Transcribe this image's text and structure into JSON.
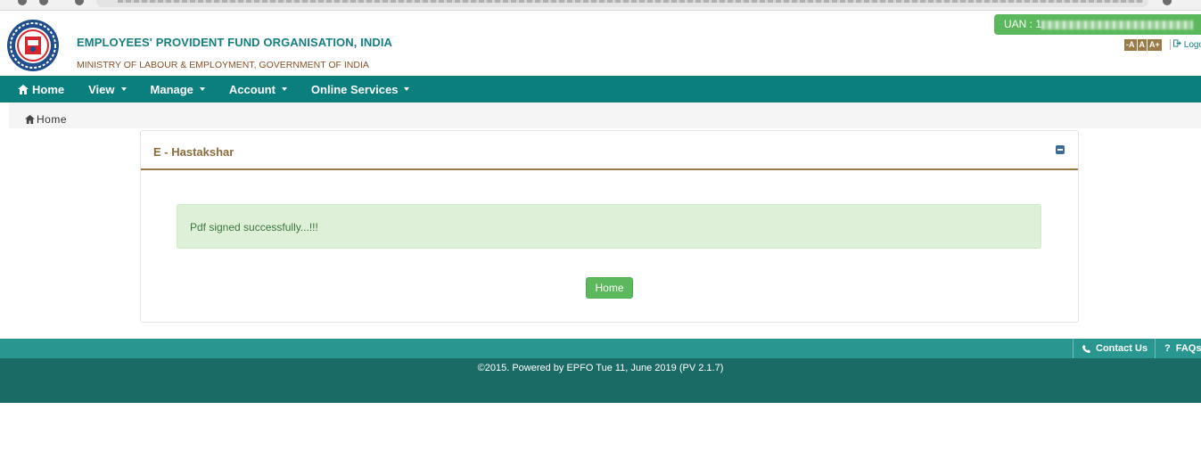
{
  "header": {
    "org_title": "EMPLOYEES' PROVIDENT FUND ORGANISATION, INDIA",
    "ministry": "MINISTRY OF LABOUR & EMPLOYMENT, GOVERNMENT OF INDIA",
    "uan_label": "UAN : 1",
    "font_size_buttons": [
      "-A",
      "A",
      "A+"
    ],
    "logout_label": "Logo"
  },
  "nav": {
    "items": [
      {
        "label": "Home",
        "icon": "home-icon",
        "dropdown": false
      },
      {
        "label": "View",
        "dropdown": true
      },
      {
        "label": "Manage",
        "dropdown": true
      },
      {
        "label": "Account",
        "dropdown": true
      },
      {
        "label": "Online Services",
        "dropdown": true
      }
    ]
  },
  "breadcrumb": {
    "label": "Home"
  },
  "panel": {
    "title": "E - Hastakshar",
    "message": "Pdf signed successfully...!!!",
    "home_button": "Home"
  },
  "footer": {
    "contact_label": "Contact Us",
    "faqs_label": "FAQs",
    "copyright": "©2015. Powered by EPFO Tue 11, June 2019 (PV 2.1.7)"
  },
  "colors": {
    "primary_teal": "#0b7e7e",
    "footer_dark": "#1a6a66",
    "footer_light": "#2a9690",
    "success_green": "#5cb85c",
    "accent_brown": "#9b7a47"
  }
}
